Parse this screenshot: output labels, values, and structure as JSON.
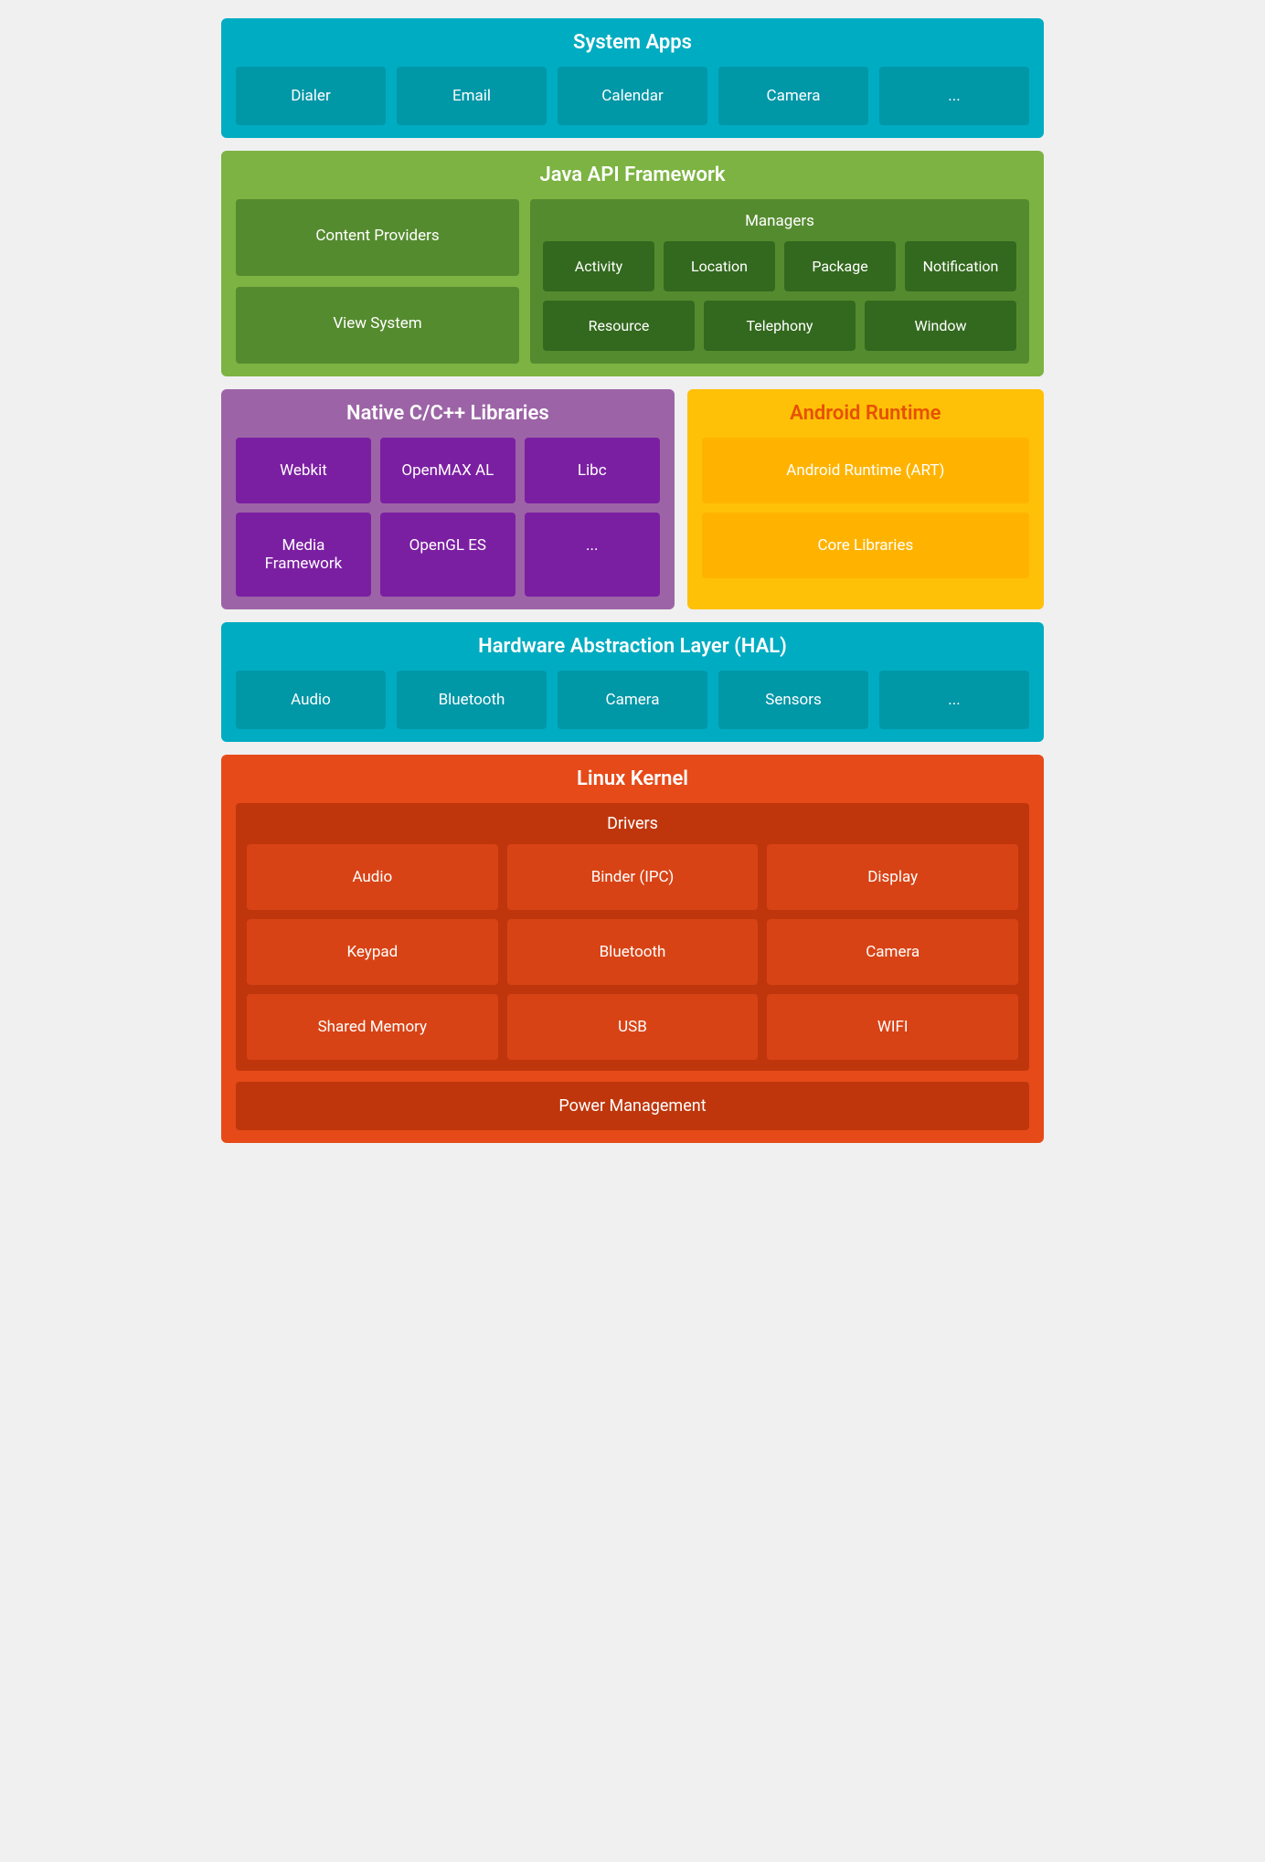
{
  "system_apps": {
    "title": "System Apps",
    "items": [
      "Dialer",
      "Email",
      "Calendar",
      "Camera",
      "..."
    ]
  },
  "java_api": {
    "title": "Java API Framework",
    "left": [
      "Content Providers",
      "View System"
    ],
    "managers_title": "Managers",
    "managers_row1": [
      "Activity",
      "Location",
      "Package",
      "Notification"
    ],
    "managers_row2": [
      "Resource",
      "Telephony",
      "Window"
    ]
  },
  "native_libs": {
    "title": "Native C/C++ Libraries",
    "row1": [
      "Webkit",
      "OpenMAX AL",
      "Libc"
    ],
    "row2": [
      "Media Framework",
      "OpenGL ES",
      "..."
    ]
  },
  "android_runtime": {
    "title": "Android Runtime",
    "items": [
      "Android Runtime (ART)",
      "Core Libraries"
    ]
  },
  "hal": {
    "title": "Hardware Abstraction Layer (HAL)",
    "items": [
      "Audio",
      "Bluetooth",
      "Camera",
      "Sensors",
      "..."
    ]
  },
  "linux_kernel": {
    "title": "Linux Kernel",
    "drivers_title": "Drivers",
    "row1": [
      "Audio",
      "Binder (IPC)",
      "Display"
    ],
    "row2": [
      "Keypad",
      "Bluetooth",
      "Camera"
    ],
    "row3": [
      "Shared Memory",
      "USB",
      "WIFI"
    ],
    "power_management": "Power Management"
  }
}
